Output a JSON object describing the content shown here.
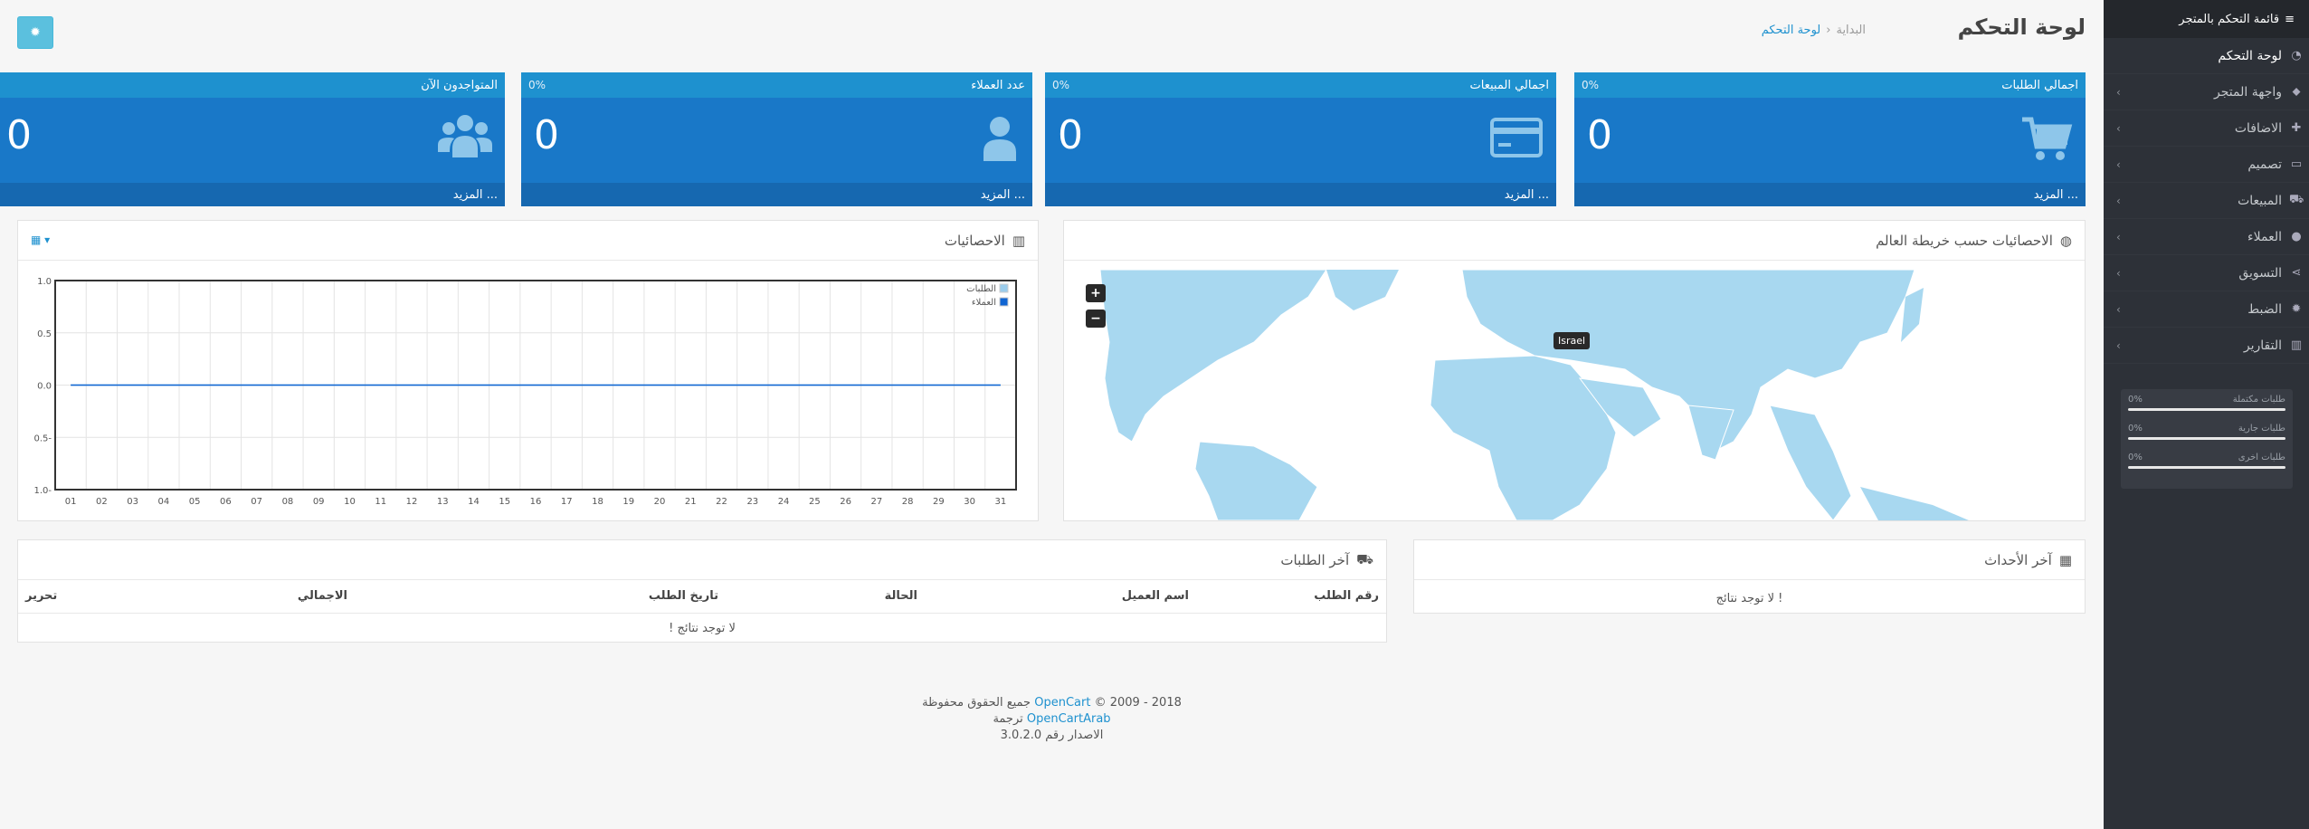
{
  "sidebar": {
    "title": "قائمة التحكم بالمتجر",
    "items": [
      {
        "label": "لوحة التحكم",
        "icon": "dashboard-icon",
        "has_children": false
      },
      {
        "label": "واجهة المتجر",
        "icon": "tag-icon",
        "has_children": true
      },
      {
        "label": "الاضافات",
        "icon": "puzzle-icon",
        "has_children": true
      },
      {
        "label": "تصميم",
        "icon": "monitor-icon",
        "has_children": true
      },
      {
        "label": "المبيعات",
        "icon": "cart-icon",
        "has_children": true
      },
      {
        "label": "العملاء",
        "icon": "user-icon",
        "has_children": true
      },
      {
        "label": "التسويق",
        "icon": "share-icon",
        "has_children": true
      },
      {
        "label": "الضبط",
        "icon": "gear-icon",
        "has_children": true
      },
      {
        "label": "التقارير",
        "icon": "bar-chart-icon",
        "has_children": true
      }
    ],
    "stats": [
      {
        "label": "طلبات مكتملة",
        "value": "0%",
        "progress": 0
      },
      {
        "label": "طلبات جارية",
        "value": "0%",
        "progress": 0
      },
      {
        "label": "طلبات اخرى",
        "value": "0%",
        "progress": 0
      }
    ]
  },
  "header": {
    "title": "لوحة التحكم",
    "breadcrumb": [
      {
        "label": "البداية"
      },
      {
        "label": "لوحة التحكم"
      }
    ],
    "breadcrumb_sep": "›"
  },
  "tiles": [
    {
      "title": "اجمالي الطلبات",
      "pct": "0%",
      "value": "0",
      "more": "المزيد ...",
      "icon": "cart-icon"
    },
    {
      "title": "اجمالي المبيعات",
      "pct": "0%",
      "value": "0",
      "more": "المزيد ...",
      "icon": "credit-card-icon"
    },
    {
      "title": "عدد العملاء",
      "pct": "0%",
      "value": "0",
      "more": "المزيد ...",
      "icon": "user-icon"
    },
    {
      "title": "المتواجدون الآن",
      "pct": "",
      "value": "0",
      "more": "المزيد ...",
      "icon": "users-icon"
    }
  ],
  "map_panel": {
    "title": "الاحصائيات حسب خريطة العالم",
    "tooltip": "Israel",
    "zoom_in": "+",
    "zoom_out": "−"
  },
  "chart_panel": {
    "title": "الاحصائيات"
  },
  "chart_data": {
    "type": "line",
    "x": [
      "01",
      "02",
      "03",
      "04",
      "05",
      "06",
      "07",
      "08",
      "09",
      "10",
      "11",
      "12",
      "13",
      "14",
      "15",
      "16",
      "17",
      "18",
      "19",
      "20",
      "21",
      "22",
      "23",
      "24",
      "25",
      "26",
      "27",
      "28",
      "29",
      "30",
      "31"
    ],
    "yticks": [
      "1.0",
      "0.5",
      "0.0",
      "0.5-",
      "1.0-"
    ],
    "ylim": [
      -1,
      1
    ],
    "series": [
      {
        "name": "الطلبات",
        "color": "#9bcdec",
        "values": [
          0,
          0,
          0,
          0,
          0,
          0,
          0,
          0,
          0,
          0,
          0,
          0,
          0,
          0,
          0,
          0,
          0,
          0,
          0,
          0,
          0,
          0,
          0,
          0,
          0,
          0,
          0,
          0,
          0,
          0,
          0
        ]
      },
      {
        "name": "العملاء",
        "color": "#1065d2",
        "values": [
          0,
          0,
          0,
          0,
          0,
          0,
          0,
          0,
          0,
          0,
          0,
          0,
          0,
          0,
          0,
          0,
          0,
          0,
          0,
          0,
          0,
          0,
          0,
          0,
          0,
          0,
          0,
          0,
          0,
          0,
          0
        ]
      }
    ],
    "grid": true,
    "legend": "top-right"
  },
  "events_panel": {
    "title": "آخر الأحداث",
    "empty": "لا توجد نتائج !"
  },
  "orders_panel": {
    "title": "آخر الطلبات",
    "columns": [
      "رقم الطلب",
      "اسم العميل",
      "الحالة",
      "تاريخ الطلب",
      "الاجمالي",
      "تحرير"
    ],
    "empty": "لا توجد نتائج !"
  },
  "footer": {
    "years": "2009 - 2018",
    "brand": "OpenCart",
    "copy_symbol": "©",
    "rights": "جميع الحقوق محفوظة",
    "translation_label": "ترجمة",
    "translator": "OpenCartArab",
    "version": "الاصدار رقم 3.0.2.0"
  },
  "colors": {
    "primary": "#1e91cf",
    "tile_body": "#1978c8",
    "sidebar": "#2d3138",
    "map_land": "#a8d8f0"
  }
}
